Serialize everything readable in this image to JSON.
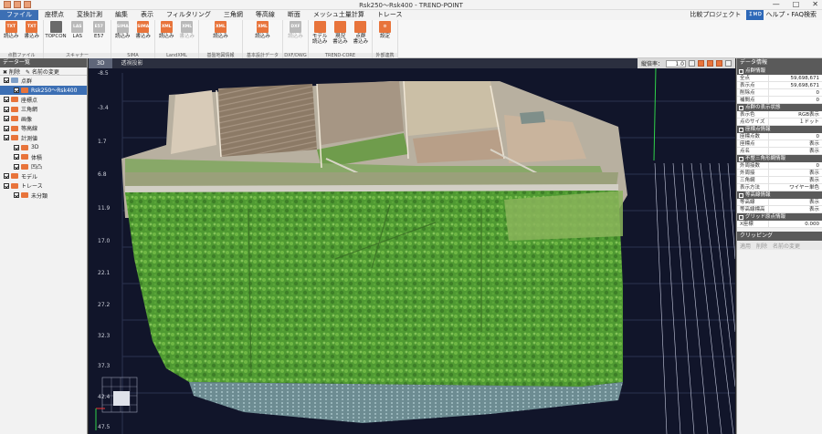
{
  "window": {
    "title": "Rsk250～Rsk400 - TREND-POINT",
    "controls": [
      "—",
      "□",
      "✕"
    ]
  },
  "menu": {
    "items": [
      {
        "label": "ファイル",
        "active": true
      },
      {
        "label": "座標点"
      },
      {
        "label": "変換計測"
      },
      {
        "label": "編集"
      },
      {
        "label": "表示"
      },
      {
        "label": "フィルタリング"
      },
      {
        "label": "三角網"
      },
      {
        "label": "等高線"
      },
      {
        "label": "断面"
      },
      {
        "label": "メッシュ土量計算"
      },
      {
        "label": "トレース"
      }
    ],
    "compare_project": "比較プロジェクト",
    "help_badge": "ＩＭＤ",
    "help": "ヘルプ・FAQ検索"
  },
  "ribbon": {
    "groups": [
      {
        "name": "点群ファイル",
        "buttons": [
          {
            "icon": "TXT",
            "label": "読込み"
          },
          {
            "icon": "TXT",
            "label": "書込み"
          }
        ]
      },
      {
        "name": "スキャナー",
        "buttons": [
          {
            "icon": "",
            "label": "TOPCON"
          },
          {
            "icon": "LAS",
            "label": "LAS"
          },
          {
            "icon": "E57",
            "label": "E57"
          }
        ]
      },
      {
        "name": "SIMA",
        "buttons": [
          {
            "icon": "SIMA",
            "label": "読込み"
          },
          {
            "icon": "SIMA",
            "label": "書込み"
          }
        ]
      },
      {
        "name": "LandXML",
        "buttons": [
          {
            "icon": "XML",
            "label": "読込み"
          },
          {
            "icon": "XML",
            "label": "書込み"
          }
        ]
      },
      {
        "name": "基盤地図情報",
        "buttons": [
          {
            "icon": "XML",
            "label": "読込み"
          }
        ]
      },
      {
        "name": "基本設計データ",
        "buttons": [
          {
            "icon": "XML",
            "label": "読込み"
          }
        ]
      },
      {
        "name": "DXF/DWG",
        "buttons": [
          {
            "icon": "DXF",
            "label": "読込み"
          }
        ]
      },
      {
        "name": "TREND-CORE",
        "buttons": [
          {
            "icon": "",
            "label": "モデル\n読込み"
          },
          {
            "icon": "",
            "label": "現況\n書込み"
          },
          {
            "icon": "",
            "label": "点群\n書込み"
          }
        ]
      },
      {
        "name": "外部連携",
        "buttons": [
          {
            "icon": "",
            "label": "設定"
          }
        ]
      }
    ]
  },
  "left_panel": {
    "title": "データ一覧",
    "tools": [
      "削除",
      "名前の変更"
    ],
    "tree": [
      {
        "label": "点群",
        "level": 0,
        "checked": true,
        "color": "#7fa0c8"
      },
      {
        "label": "Rsk250～Rsk400",
        "level": 1,
        "checked": true,
        "selected": true,
        "color": "#e8743b"
      },
      {
        "label": "座標点",
        "level": 0,
        "checked": true,
        "color": "#e8743b"
      },
      {
        "label": "三角網",
        "level": 0,
        "checked": true,
        "color": "#e8743b"
      },
      {
        "label": "画像",
        "level": 0,
        "checked": true,
        "color": "#e8743b"
      },
      {
        "label": "等高線",
        "level": 0,
        "checked": true,
        "color": "#e8743b"
      },
      {
        "label": "計測値",
        "level": 0,
        "checked": true,
        "color": "#e8743b"
      },
      {
        "label": "3D",
        "level": 1,
        "checked": true,
        "color": "#e8743b"
      },
      {
        "label": "体積",
        "level": 1,
        "checked": true,
        "color": "#e8743b"
      },
      {
        "label": "凹凸",
        "level": 1,
        "checked": true,
        "color": "#e8743b"
      },
      {
        "label": "モデル",
        "level": 0,
        "checked": true,
        "color": "#e8743b"
      },
      {
        "label": "トレース",
        "level": 0,
        "checked": true,
        "color": "#e8743b"
      },
      {
        "label": "未分類",
        "level": 1,
        "checked": true,
        "color": "#e8743b"
      }
    ]
  },
  "viewport": {
    "tabs": [
      {
        "label": "3D",
        "active": true
      },
      {
        "label": "透視投影"
      }
    ],
    "vertical_scale_label": "縦倍率：",
    "vertical_scale_value": "1.0",
    "y_labels": [
      "-8.5",
      "-3.4",
      "1.7",
      "6.8",
      "11.9",
      "17.0",
      "22.1",
      "27.2",
      "32.3",
      "37.3",
      "42.4",
      "47.5"
    ]
  },
  "right_panel": {
    "title": "データ情報",
    "sections": [
      {
        "title": "点群情報",
        "rows": [
          {
            "k": "全点",
            "v": "59,698,671"
          },
          {
            "k": "表示点",
            "v": "59,698,671"
          },
          {
            "k": "削除点",
            "v": "0"
          },
          {
            "k": "補間点",
            "v": "0"
          }
        ]
      },
      {
        "title": "点群の表示状態",
        "rows": [
          {
            "k": "表示色",
            "v": "RGB表示"
          },
          {
            "k": "点のサイズ",
            "v": "１ドット"
          }
        ]
      },
      {
        "title": "座標点情報",
        "rows": [
          {
            "k": "座標点数",
            "v": "0"
          },
          {
            "k": "座標点",
            "v": "表示"
          },
          {
            "k": "点名",
            "v": "表示"
          }
        ]
      },
      {
        "title": "不整三角形網情報",
        "rows": [
          {
            "k": "外周接数",
            "v": "0"
          },
          {
            "k": "外周接",
            "v": "表示"
          },
          {
            "k": "三角網",
            "v": "表示"
          },
          {
            "k": "表示方法",
            "v": "ワイヤー単色"
          }
        ]
      },
      {
        "title": "等高線情報",
        "rows": [
          {
            "k": "等高線",
            "v": "表示"
          },
          {
            "k": "等高線標高",
            "v": "表示"
          }
        ]
      },
      {
        "title": "グリッド原点情報",
        "rows": [
          {
            "k": "X座標",
            "v": "0.000"
          }
        ]
      }
    ],
    "clipping": {
      "title": "クリッピング",
      "tools": [
        "適用",
        "削除",
        "名前の変更"
      ]
    }
  }
}
